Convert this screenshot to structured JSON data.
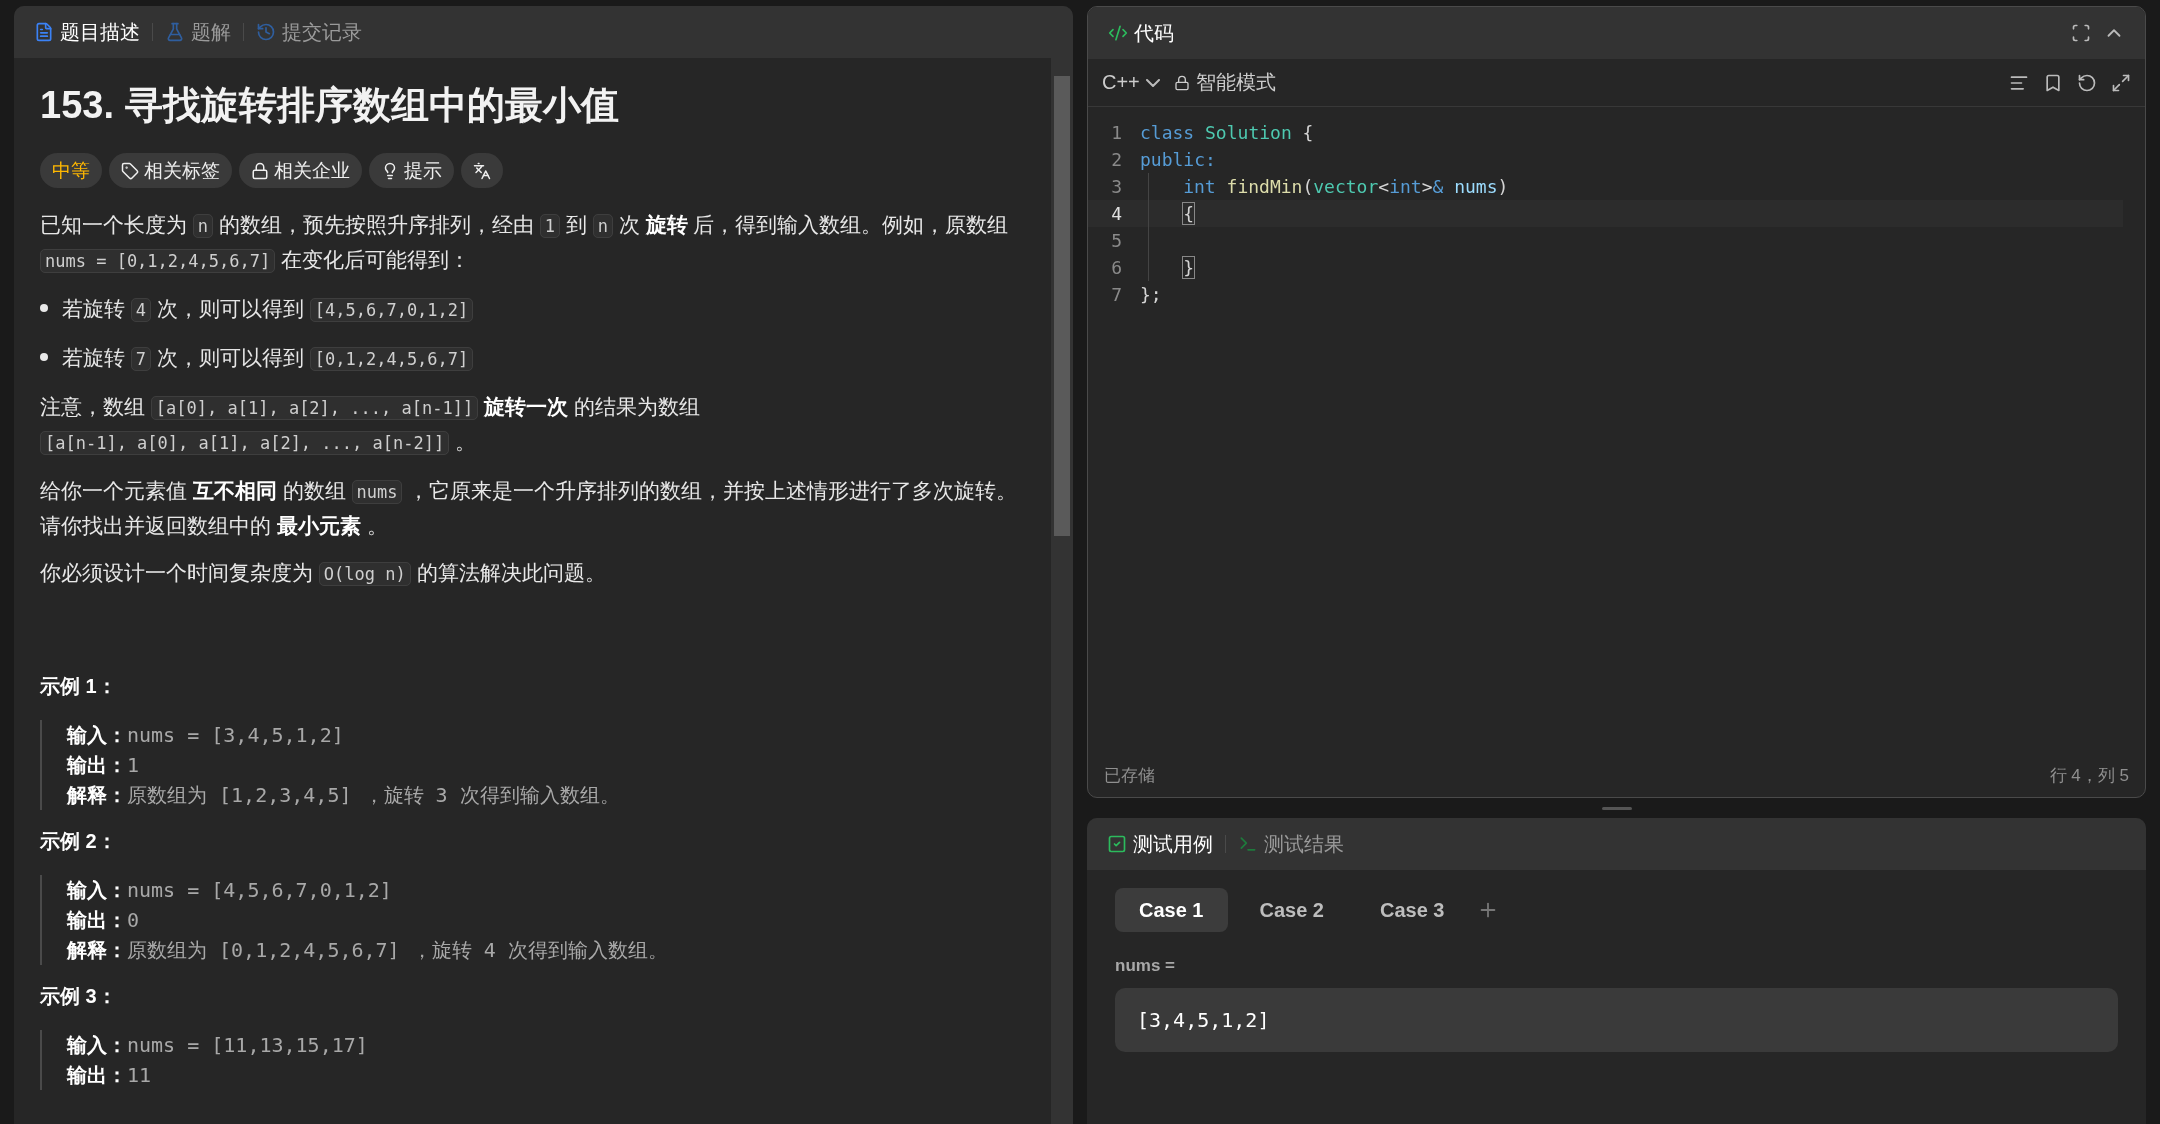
{
  "problem_panel": {
    "tabs": [
      {
        "kind": "doc",
        "label": "题目描述",
        "selected": true
      },
      {
        "kind": "flask",
        "label": "题解",
        "selected": false
      },
      {
        "kind": "history",
        "label": "提交记录",
        "selected": false
      }
    ],
    "title": "153. 寻找旋转排序数组中的最小值",
    "tags": [
      {
        "kind": "difficulty",
        "label": "中等"
      },
      {
        "kind": "tag",
        "label": "相关标签"
      },
      {
        "kind": "lock",
        "label": "相关企业"
      },
      {
        "kind": "hint",
        "label": "提示"
      },
      {
        "kind": "translate"
      }
    ],
    "description": [
      {
        "kind": "paragraph",
        "segments": [
          {
            "kind": "text",
            "text": "已知一个长度为 "
          },
          {
            "kind": "code",
            "text": "n"
          },
          {
            "kind": "text",
            "text": " 的数组，预先按照升序排列，经由 "
          },
          {
            "kind": "code",
            "text": "1"
          },
          {
            "kind": "text",
            "text": " 到 "
          },
          {
            "kind": "code",
            "text": "n"
          },
          {
            "kind": "text",
            "text": " 次 **旋转** 后，得到输入数组。例如，原数组 "
          },
          {
            "kind": "code",
            "text": "nums = [0,1,2,4,5,6,7]"
          },
          {
            "kind": "text",
            "text": " 在变化后可能得到："
          }
        ]
      },
      {
        "kind": "bullet",
        "segments": [
          {
            "kind": "text",
            "text": "若旋转 "
          },
          {
            "kind": "code",
            "text": "4"
          },
          {
            "kind": "text",
            "text": " 次，则可以得到 "
          },
          {
            "kind": "code",
            "text": "[4,5,6,7,0,1,2]"
          }
        ]
      },
      {
        "kind": "bullet",
        "segments": [
          {
            "kind": "text",
            "text": "若旋转 "
          },
          {
            "kind": "code",
            "text": "7"
          },
          {
            "kind": "text",
            "text": " 次，则可以得到 "
          },
          {
            "kind": "code",
            "text": "[0,1,2,4,5,6,7]"
          }
        ]
      },
      {
        "kind": "paragraph",
        "segments": [
          {
            "kind": "text",
            "text": "注意，数组 "
          },
          {
            "kind": "code",
            "text": "[a[0], a[1], a[2], ..., a[n-1]]"
          },
          {
            "kind": "text",
            "text": " **旋转一次** 的结果为数组 "
          },
          {
            "kind": "code",
            "text": "[a[n-1], a[0], a[1], a[2], ..., a[n-2]]"
          },
          {
            "kind": "text",
            "text": " 。"
          }
        ]
      },
      {
        "kind": "paragraph",
        "segments": [
          {
            "kind": "text",
            "text": "给你一个元素值 **互不相同** 的数组 "
          },
          {
            "kind": "code",
            "text": "nums"
          },
          {
            "kind": "text",
            "text": " ，它原来是一个升序排列的数组，并按上述情形进行了多次旋转。请你找出并返回数组中的 **最小元素** 。"
          }
        ]
      },
      {
        "kind": "paragraph",
        "segments": [
          {
            "kind": "text",
            "text": "你必须设计一个时间复杂度为 "
          },
          {
            "kind": "code",
            "text": "O(log n)"
          },
          {
            "kind": "text",
            "text": " 的算法解决此问题。"
          }
        ]
      }
    ],
    "examples": [
      {
        "title": "示例 1：",
        "lines": [
          {
            "label": "输入：",
            "value": "nums = [3,4,5,1,2]"
          },
          {
            "label": "输出：",
            "value": "1"
          },
          {
            "label": "解释：",
            "value": "原数组为 [1,2,3,4,5] ，旋转 3 次得到输入数组。"
          }
        ]
      },
      {
        "title": "示例 2：",
        "lines": [
          {
            "label": "输入：",
            "value": "nums = [4,5,6,7,0,1,2]"
          },
          {
            "label": "输出：",
            "value": "0"
          },
          {
            "label": "解释：",
            "value": "原数组为 [0,1,2,4,5,6,7] ，旋转 4 次得到输入数组。"
          }
        ]
      },
      {
        "title": "示例 3：",
        "lines": [
          {
            "label": "输入：",
            "value": "nums = [11,13,15,17]"
          },
          {
            "label": "输出：",
            "value": "11"
          }
        ]
      }
    ]
  },
  "editor": {
    "title": "代码",
    "language": "C++",
    "mode": "智能模式",
    "lines": [
      {
        "number": "1",
        "current": false,
        "indented": false,
        "tokens": [
          {
            "kind": "keyword",
            "text": "class "
          },
          {
            "kind": "type",
            "text": "Solution"
          },
          {
            "kind": "plain",
            "text": " {"
          }
        ]
      },
      {
        "number": "2",
        "current": false,
        "indented": false,
        "tokens": [
          {
            "kind": "keyword",
            "text": "public:"
          }
        ]
      },
      {
        "number": "3",
        "current": false,
        "indented": true,
        "tokens": [
          {
            "kind": "keyword",
            "text": "int "
          },
          {
            "kind": "function",
            "text": "findMin"
          },
          {
            "kind": "plain",
            "text": "("
          },
          {
            "kind": "type",
            "text": "vector"
          },
          {
            "kind": "plain",
            "text": "<"
          },
          {
            "kind": "keyword",
            "text": "int"
          },
          {
            "kind": "plain",
            "text": ">"
          },
          {
            "kind": "keyword",
            "text": "& "
          },
          {
            "kind": "param",
            "text": "nums"
          },
          {
            "kind": "plain",
            "text": ")"
          }
        ]
      },
      {
        "number": "4",
        "current": true,
        "indented": true,
        "tokens": [
          {
            "kind": "bracket",
            "text": "{"
          }
        ]
      },
      {
        "number": "5",
        "current": false,
        "indented": true
      },
      {
        "number": "6",
        "current": false,
        "indented": true,
        "tokens": [
          {
            "kind": "bracket",
            "text": "}"
          }
        ]
      },
      {
        "number": "7",
        "current": false,
        "indented": false,
        "tokens": [
          {
            "kind": "plain",
            "text": "};"
          }
        ]
      }
    ],
    "status": "已存储",
    "cursor": "行 4，列 5"
  },
  "test_panel": {
    "tabs": [
      {
        "kind": "check",
        "label": "测试用例",
        "selected": true
      },
      {
        "kind": "terminal",
        "label": "测试结果",
        "selected": false
      }
    ],
    "cases": [
      {
        "label": "Case 1",
        "selected": true
      },
      {
        "label": "Case 2",
        "selected": false
      },
      {
        "label": "Case 3",
        "selected": false
      }
    ],
    "param_label": "nums =",
    "param_value": "[3,4,5,1,2]"
  }
}
